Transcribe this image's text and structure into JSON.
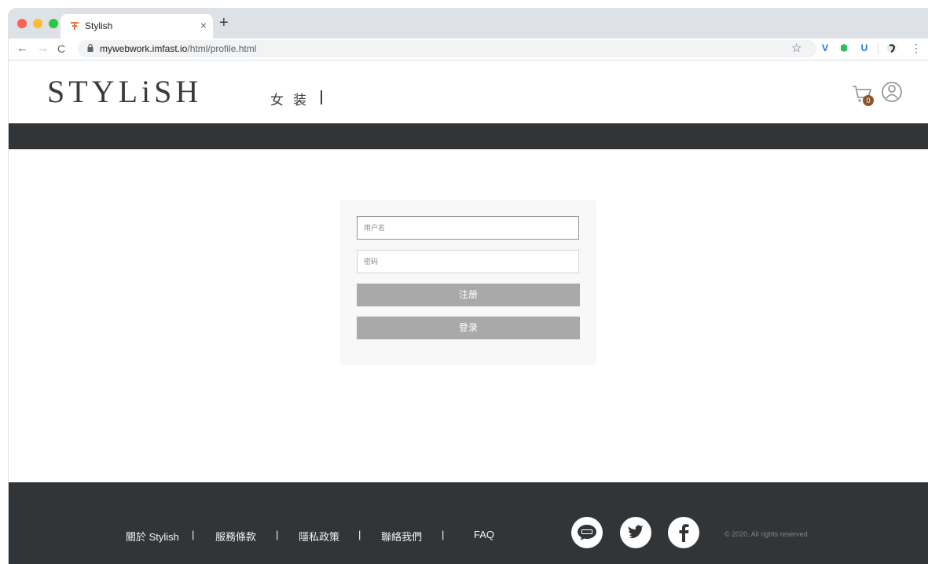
{
  "browser": {
    "tab_title": "Stylish",
    "tab_close": "×",
    "new_tab": "+",
    "url_host": "mywebwork.imfast.io",
    "url_path": "/html/profile.html",
    "star": "☆",
    "ext_v": "V",
    "ext_u": "U",
    "menu": "⋮",
    "back": "←",
    "forward": "→",
    "reload": "C"
  },
  "header": {
    "logo": "STYLiSH",
    "nav_women": "女装",
    "cart_count": "0"
  },
  "login": {
    "username_placeholder": "用户名",
    "password_placeholder": "密码",
    "register_label": "注册",
    "login_label": "登录"
  },
  "footer": {
    "links": [
      "關於 Stylish",
      "服務條款",
      "隱私政策",
      "聯絡我們",
      "FAQ"
    ],
    "separator": "|",
    "copyright": "© 2020. All rights reserved"
  },
  "colors": {
    "header_bar": "#313538",
    "button": "#a9a9a9",
    "cart_badge": "#8b572a",
    "text": "#3f3a3a"
  }
}
